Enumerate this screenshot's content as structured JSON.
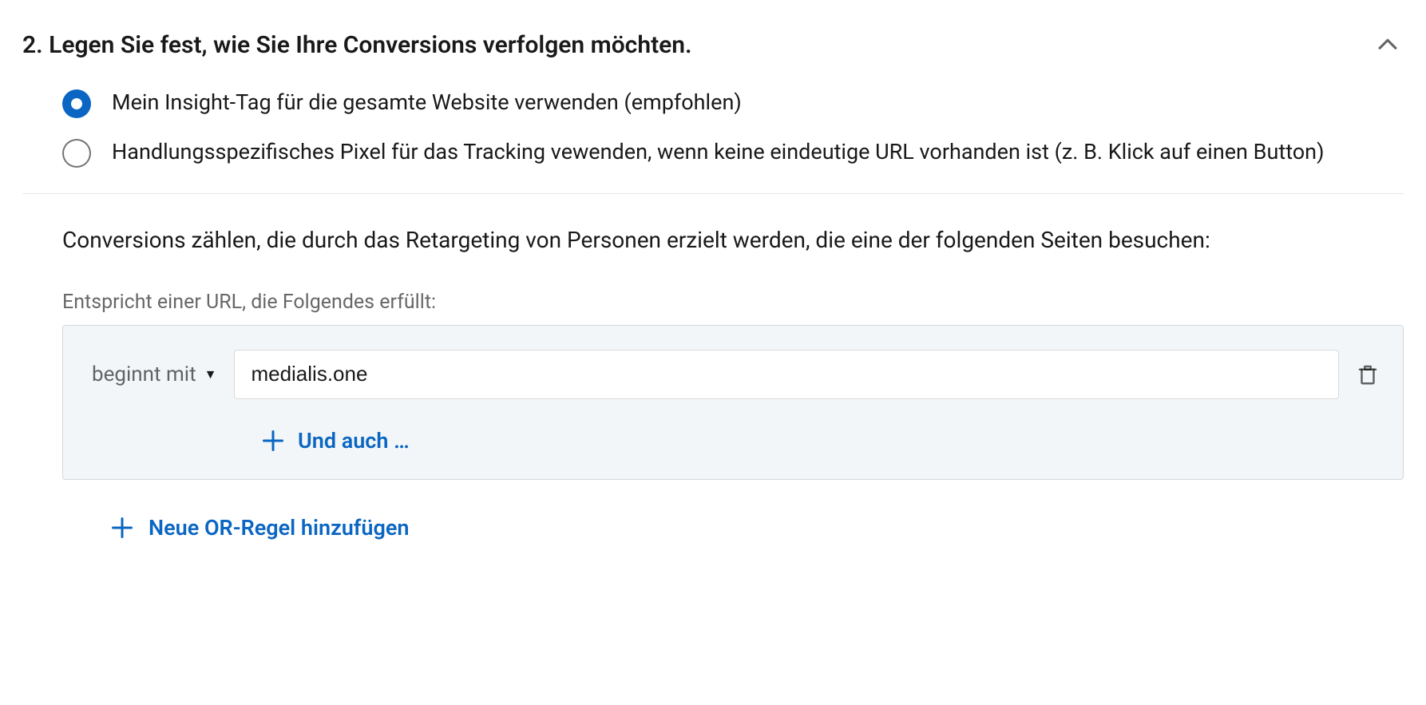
{
  "section": {
    "title": "2. Legen Sie fest, wie Sie Ihre Conversions verfolgen möchten."
  },
  "tracking_options": {
    "insight_tag": {
      "label": "Mein Insight-Tag für die gesamte Website verwenden (empfohlen)",
      "selected": true
    },
    "event_pixel": {
      "label": "Handlungsspezifisches Pixel für das Tracking vewenden, wenn keine eindeutige URL vorhanden ist (z. B. Klick auf einen Button)",
      "selected": false
    }
  },
  "rules": {
    "description": "Conversions zählen, die durch das Retargeting von Personen erzielt werden, die eine der folgenden Seiten besuchen:",
    "field_label": "Entspricht einer URL, die Folgendes erfüllt:",
    "conditions": [
      {
        "match_type": "beginnt mit",
        "value": "medialis.one"
      }
    ],
    "add_and_label": "Und auch …",
    "add_or_label": "Neue OR-Regel hinzufügen"
  }
}
